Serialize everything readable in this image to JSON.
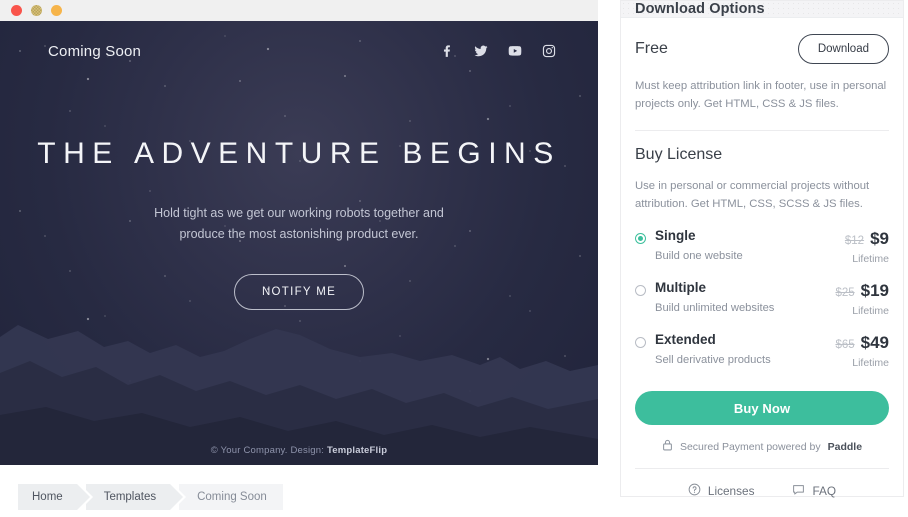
{
  "browser": {
    "dots": [
      "close-red",
      "minimize-yellow",
      "maximize-orange"
    ]
  },
  "preview": {
    "brand": "Coming Soon",
    "socials": [
      {
        "name": "facebook-icon",
        "label": "Facebook"
      },
      {
        "name": "twitter-icon",
        "label": "Twitter"
      },
      {
        "name": "youtube-icon",
        "label": "YouTube"
      },
      {
        "name": "instagram-icon",
        "label": "Instagram"
      }
    ],
    "headline": "THE ADVENTURE BEGINS",
    "subline": "Hold tight as we get our working robots together and produce the most astonishing product ever.",
    "notify_label": "NOTIFY ME",
    "footer_prefix": "© Your Company. Design: ",
    "footer_brand": "TemplateFlip"
  },
  "breadcrumb": [
    {
      "label": "Home"
    },
    {
      "label": "Templates"
    },
    {
      "label": "Coming Soon"
    }
  ],
  "panel": {
    "title": "Download Options",
    "free": {
      "heading": "Free",
      "button_label": "Download",
      "description": "Must keep attribution link in footer, use in personal projects only. Get HTML, CSS & JS files."
    },
    "buy": {
      "heading": "Buy License",
      "description": "Use in personal or commercial projects without attribution. Get HTML, CSS, SCSS & JS files.",
      "plans": [
        {
          "name": "Single",
          "sub": "Build one website",
          "old_price": "$12",
          "price": "$9",
          "period": "Lifetime",
          "selected": true
        },
        {
          "name": "Multiple",
          "sub": "Build unlimited websites",
          "old_price": "$25",
          "price": "$19",
          "period": "Lifetime",
          "selected": false
        },
        {
          "name": "Extended",
          "sub": "Sell derivative products",
          "old_price": "$65",
          "price": "$49",
          "period": "Lifetime",
          "selected": false
        }
      ],
      "buy_label": "Buy Now",
      "secure_prefix": "Secured Payment powered by ",
      "secure_brand": "Paddle"
    },
    "links": [
      {
        "label": "Licenses",
        "icon": "question-circle-icon"
      },
      {
        "label": "FAQ",
        "icon": "chat-bubble-icon"
      }
    ]
  },
  "colors": {
    "accent_green": "#3dbe9d",
    "hero_dark": "#2b2e47",
    "panel_head_bg": "#f4f4f6",
    "text_dark": "#3a4049",
    "text_muted": "#8b919c"
  }
}
